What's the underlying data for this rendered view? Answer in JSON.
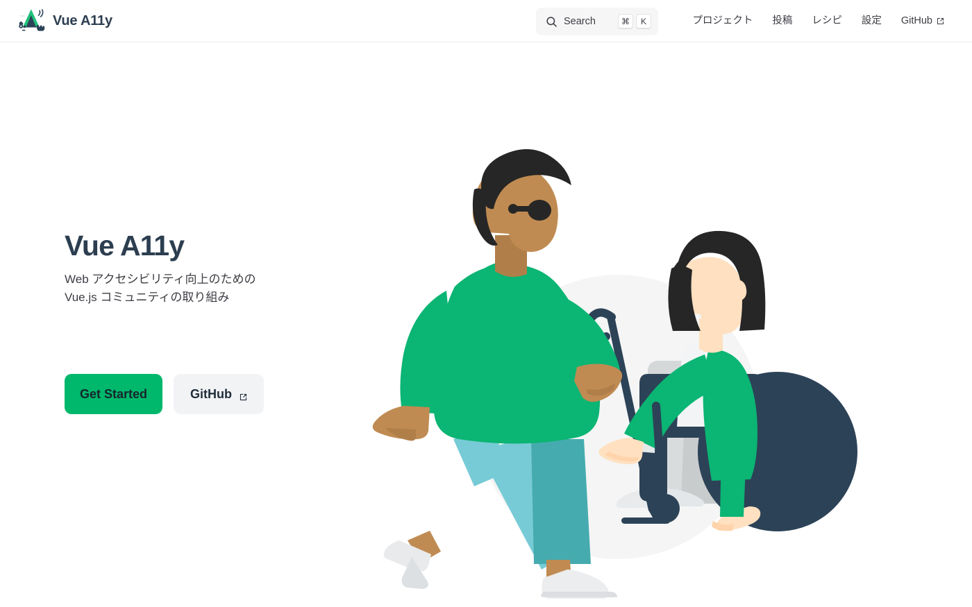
{
  "header": {
    "brand": {
      "logo_icon": "vue-a11y-logo-icon",
      "title": "Vue A11y"
    },
    "search": {
      "icon": "search-icon",
      "label": "Search",
      "keys": [
        "⌘",
        "K"
      ]
    },
    "nav": [
      {
        "label": "プロジェクト",
        "external": false
      },
      {
        "label": "投稿",
        "external": false
      },
      {
        "label": "レシピ",
        "external": false
      },
      {
        "label": "設定",
        "external": false
      },
      {
        "label": "GitHub",
        "external": true,
        "external_icon": "external-link-icon"
      }
    ]
  },
  "hero": {
    "title": "Vue A11y",
    "tagline": "Web アクセシビリティ向上のための\nVue.js コミュニティの取り組み",
    "actions": {
      "primary_label": "Get Started",
      "secondary_label": "GitHub",
      "secondary_icon": "external-link-icon"
    },
    "illustration": {
      "name": "accessibility-people-illustration",
      "description": "Person walking with a white cane next to a person seated in a wheelchair"
    }
  },
  "colors": {
    "brand_green": "#00b86b",
    "illustration_green": "#0bb573",
    "navy": "#2c4257",
    "text_dark": "#2c3e50",
    "text_body": "#3c3c43",
    "search_bg": "#f6f6f7",
    "secondary_btn_bg": "#f1f3f5",
    "circle_bg": "#f4f5f4",
    "teal_light": "#77cbd6",
    "teal_dark": "#45abaf",
    "skin_tan": "#c08b52",
    "skin_light": "#ffe0c0",
    "hair_dark": "#262626",
    "shoe_gray": "#e8eaec",
    "frame_gray": "#c9cccd"
  }
}
